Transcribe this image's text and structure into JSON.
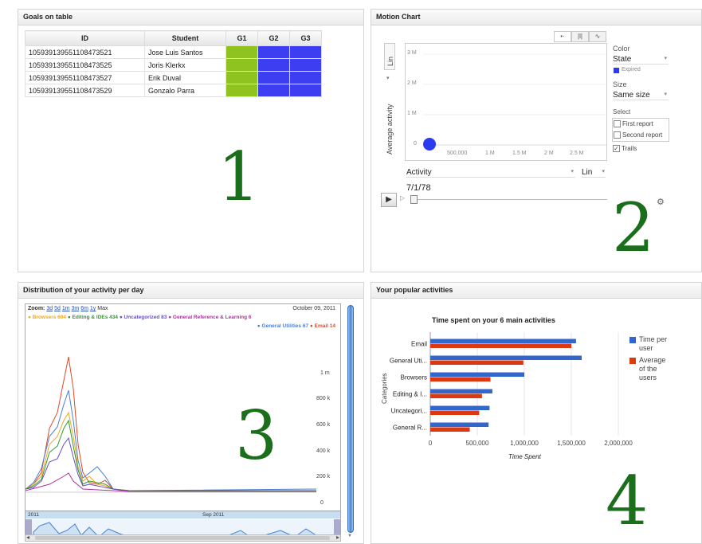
{
  "panels": {
    "goals": {
      "title": "Goals on table",
      "columns": [
        "ID",
        "Student",
        "G1",
        "G2",
        "G3"
      ],
      "rows": [
        {
          "id": "105939139551108473521",
          "student": "Jose Luis Santos",
          "g": [
            "green",
            "blue",
            "blue"
          ]
        },
        {
          "id": "105939139551108473525",
          "student": "Joris Klerkx",
          "g": [
            "green",
            "blue",
            "blue"
          ]
        },
        {
          "id": "105939139551108473527",
          "student": "Erik Duval",
          "g": [
            "green",
            "blue",
            "blue"
          ]
        },
        {
          "id": "105939139551108473529",
          "student": "Gonzalo Parra",
          "g": [
            "green",
            "blue",
            "blue"
          ]
        }
      ],
      "colors": {
        "green": "#8fc31f",
        "blue": "#3d3df1"
      },
      "number": "1"
    },
    "motion": {
      "title": "Motion Chart",
      "yscale": "Lin",
      "ylabel": "Average activity",
      "yticks": [
        "3 M",
        "2 M",
        "1 M",
        "0"
      ],
      "xticks": [
        "500,000",
        "1 M",
        "1.5 M",
        "2 M",
        "2.5 M"
      ],
      "color_label": "Color",
      "color_value": "State",
      "color_legend": "Expired",
      "size_label": "Size",
      "size_value": "Same size",
      "select_label": "Select",
      "checks": [
        {
          "label": "First report",
          "checked": false
        },
        {
          "label": "Second report",
          "checked": false
        },
        {
          "label": "Trails",
          "checked": true
        }
      ],
      "xaxis_value": "Activity",
      "xscale": "Lin",
      "date": "7/1/78",
      "bubble_color": "#2b3cf0",
      "number": "2"
    },
    "distribution": {
      "title": "Distribution of your activity per day",
      "zoom_label": "Zoom:",
      "zoom_options": [
        "3d",
        "5d",
        "1m",
        "3m",
        "6m",
        "1y",
        "Max"
      ],
      "date": "October 09, 2011",
      "legend": [
        {
          "label": "Browsers 604",
          "color": "#f0a81c"
        },
        {
          "label": "Editing & IDEs 434",
          "color": "#2c9a2c"
        },
        {
          "label": "Uncategorized 83",
          "color": "#6a4dc8"
        },
        {
          "label": "General Reference & Learning 6",
          "color": "#b0309e"
        },
        {
          "label": "General Utilities 67",
          "color": "#4a7fd6"
        },
        {
          "label": "Email 14",
          "color": "#e04a2a"
        }
      ],
      "yticks": [
        "1 m",
        "800 k",
        "600 k",
        "400 k",
        "200 k",
        "0"
      ],
      "timeline": [
        "2011",
        "Sep 2011"
      ],
      "number": "3"
    },
    "popular": {
      "title": "Your popular activities",
      "number": "4"
    }
  },
  "chart_data": {
    "type": "bar",
    "title": "Time spent on your 6 main activities",
    "xlabel": "Time Spent",
    "ylabel": "Categories",
    "categories": [
      "Email",
      "General Uti...",
      "Browsers",
      "Editing & I...",
      "Uncategori...",
      "General R..."
    ],
    "series": [
      {
        "name": "Time per user",
        "color": "#3366cc",
        "values": [
          1550000,
          1610000,
          1000000,
          660000,
          630000,
          620000
        ]
      },
      {
        "name": "Average of the users",
        "color": "#dc3912",
        "values": [
          1500000,
          990000,
          640000,
          550000,
          520000,
          420000
        ]
      }
    ],
    "xlim": [
      0,
      2000000
    ],
    "xticks": [
      "0",
      "500,000",
      "1,000,000",
      "1,500,000",
      "2,000,000"
    ],
    "legend": "right"
  }
}
